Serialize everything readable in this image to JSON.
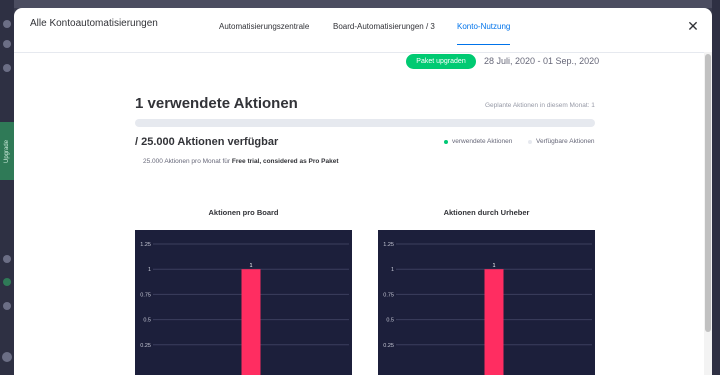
{
  "modal": {
    "title": "Alle Kontoautomatisierungen",
    "close_icon": "close-icon",
    "tabs": [
      {
        "label": "Automatisierungszentrale",
        "active": false
      },
      {
        "label": "Board-Automatisierungen / 3",
        "active": false
      },
      {
        "label": "Konto-Nutzung",
        "active": true
      }
    ]
  },
  "sidebar": {
    "upgrade_label": "Upgrade"
  },
  "usage": {
    "upgrade_button": "Paket upgraden",
    "date_range": "28 Juli, 2020 - 01 Sep., 2020",
    "used_title": "1 verwendete Aktionen",
    "planned_label": "Geplante Aktionen in diesem Monat: 1",
    "used_fraction": 4e-05,
    "available_title": "/ 25.000 Aktionen verfügbar",
    "legend_used": "verwendete Aktionen",
    "legend_available": "Verfügbare Aktionen",
    "plan_note_prefix": "25.000 Aktionen pro Monat für ",
    "plan_note_bold": "Free trial, considered as Pro Paket",
    "colors": {
      "used": "#00c875",
      "available": "#e6e9ef",
      "bar": "#ff2d61",
      "chart_bg": "#1c1f3b",
      "accent": "#0073ea",
      "button": "#00ca72"
    }
  },
  "chart_data": [
    {
      "type": "bar",
      "title": "Aktionen pro Board",
      "categories": [
        ""
      ],
      "values": [
        1
      ],
      "data_labels": [
        "1"
      ],
      "yticks": [
        "1.25",
        "1",
        "0.75",
        "0.5",
        "0.25"
      ],
      "ylim": [
        0,
        1.25
      ],
      "grid": true
    },
    {
      "type": "bar",
      "title": "Aktionen durch Urheber",
      "categories": [
        ""
      ],
      "values": [
        1
      ],
      "data_labels": [
        "1"
      ],
      "yticks": [
        "1.25",
        "1",
        "0.75",
        "0.5",
        "0.25"
      ],
      "ylim": [
        0,
        1.25
      ],
      "grid": true
    }
  ]
}
